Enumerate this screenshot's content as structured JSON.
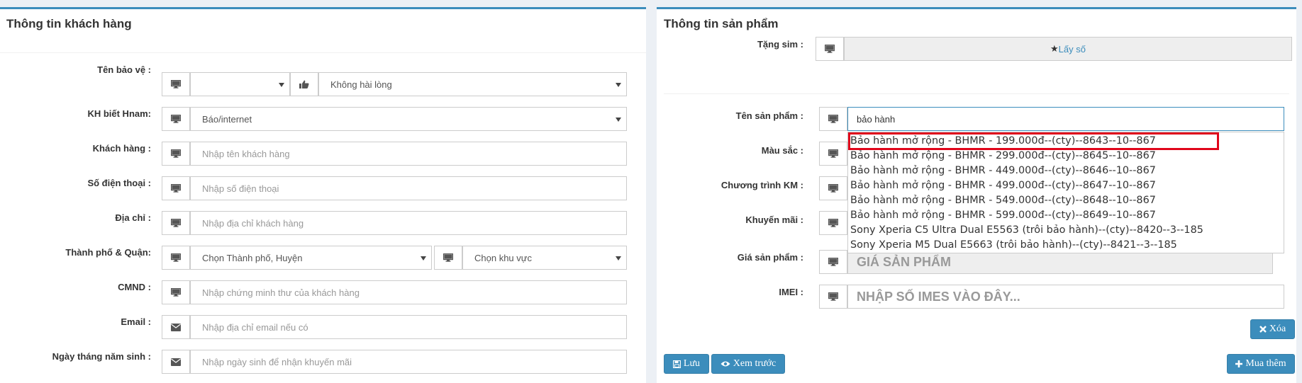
{
  "customer": {
    "title": "Thông tin khách hàng",
    "rows": {
      "warranty_name_label": "Tên bảo vệ :",
      "warranty_select_value": "",
      "satisfaction_value": "Không hài lòng",
      "source_label": "KH biết Hnam:",
      "source_value": "Báo/internet",
      "name_label": "Khách hàng :",
      "name_placeholder": "Nhập tên khách hàng",
      "phone_label": "Số điện thoại :",
      "phone_placeholder": "Nhập số điện thoại",
      "address_label": "Địa chỉ :",
      "address_placeholder": "Nhập địa chỉ khách hàng",
      "city_label": "Thành phố & Quận:",
      "city_value": "Chọn Thành phố, Huyện",
      "area_value": "Chọn khu vực",
      "id_label": "CMND :",
      "id_placeholder": "Nhập chứng minh thư của khách hàng",
      "email_label": "Email :",
      "email_placeholder": "Nhập địa chỉ email nếu có",
      "dob_label": "Ngày tháng năm sinh :",
      "dob_placeholder": "Nhập ngày sinh để nhận khuyến mãi"
    }
  },
  "product": {
    "title": "Thông tin sản phẩm",
    "sim_label": "Tặng sim :",
    "sim_button": "Lấy số",
    "name_label": "Tên sản phẩm :",
    "name_value": "bảo hành",
    "color_label": "Màu sắc :",
    "program_label": "Chương trình KM :",
    "promo_label": "Khuyến mãi :",
    "price_label": "Giá sản phẩm :",
    "price_placeholder": "GIÁ SẢN PHẨM",
    "imei_label": "IMEI :",
    "imei_placeholder": "NHẬP SỐ IMES VÀO ĐÂY...",
    "delete_button": "Xóa",
    "save_button": "Lưu",
    "preview_button": "Xem trước",
    "buy_button": "Mua thêm"
  },
  "suggestions": [
    "Bảo hành mở rộng - BHMR - 199.000đ--(cty)--8643--10--867",
    "Bảo hành mở rộng - BHMR - 299.000đ--(cty)--8645--10--867",
    "Bảo hành mở rộng - BHMR - 449.000đ--(cty)--8646--10--867",
    "Bảo hành mở rộng - BHMR - 499.000đ--(cty)--8647--10--867",
    "Bảo hành mở rộng - BHMR - 549.000đ--(cty)--8648--10--867",
    "Bảo hành mở rộng - BHMR - 599.000đ--(cty)--8649--10--867",
    "Sony Xperia C5 Ultra Dual E5563 (trôi bảo hành)--(cty)--8420--3--185",
    "Sony Xperia M5 Dual E5663 (trôi bảo hành)--(cty)--8421--3--185"
  ],
  "icons": {
    "field_icon": "monitor-icon",
    "satisfaction_icon": "thumbs-up-icon",
    "email_icon": "envelope-icon",
    "sim_button_icon": "star-icon",
    "delete_icon": "close-icon",
    "save_icon": "floppy-icon",
    "preview_icon": "eye-icon",
    "buy_icon": "plus-icon"
  },
  "colors": {
    "accent": "#3c8dbc",
    "highlight_border": "#e0061b",
    "background": "#ecf0f5"
  }
}
